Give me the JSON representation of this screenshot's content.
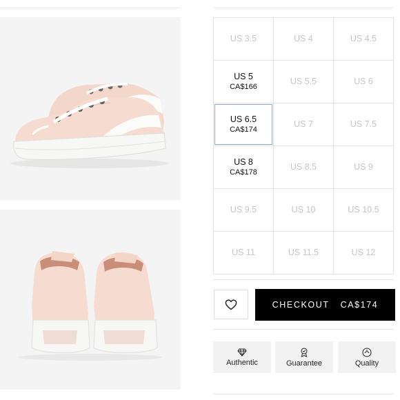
{
  "sizes": [
    {
      "size": "US 3.5",
      "price": "",
      "available": false
    },
    {
      "size": "US 4",
      "price": "",
      "available": false
    },
    {
      "size": "US 4.5",
      "price": "",
      "available": false
    },
    {
      "size": "US 5",
      "price": "CA$166",
      "available": true
    },
    {
      "size": "US 5.5",
      "price": "",
      "available": false
    },
    {
      "size": "US 6",
      "price": "",
      "available": false
    },
    {
      "size": "US 6.5",
      "price": "CA$174",
      "available": true,
      "selected": true
    },
    {
      "size": "US 7",
      "price": "",
      "available": false
    },
    {
      "size": "US 7.5",
      "price": "",
      "available": false
    },
    {
      "size": "US 8",
      "price": "CA$178",
      "available": true
    },
    {
      "size": "US 8.5",
      "price": "",
      "available": false
    },
    {
      "size": "US 9",
      "price": "",
      "available": false
    },
    {
      "size": "US 9.5",
      "price": "",
      "available": false
    },
    {
      "size": "US 10",
      "price": "",
      "available": false
    },
    {
      "size": "US 10.5",
      "price": "",
      "available": false
    },
    {
      "size": "US 11",
      "price": "",
      "available": false
    },
    {
      "size": "US 11.5",
      "price": "",
      "available": false
    },
    {
      "size": "US 12",
      "price": "",
      "available": false
    }
  ],
  "checkout": {
    "label": "CHECKOUT",
    "price": "CA$174"
  },
  "favorite": {
    "icon": "heart-icon"
  },
  "badges": [
    {
      "label": "Authentic",
      "icon": "diamond-icon"
    },
    {
      "label": "Guarantee",
      "icon": "award-ribbon-icon"
    },
    {
      "label": "Quality",
      "icon": "quality-seal-icon"
    }
  ],
  "colors": {
    "shoe": "#f6dcd0",
    "sole": "#f7f7f5",
    "accent_selected": "#86a7d8",
    "checkout_bg": "#000000"
  }
}
